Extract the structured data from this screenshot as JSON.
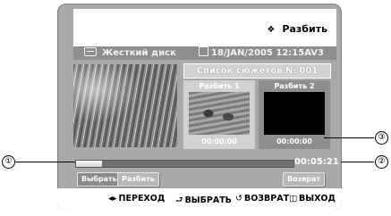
{
  "header": {
    "menu_title": "Разбить",
    "menu_icon": "diamond-icon"
  },
  "info": {
    "storage": "Жесткий диск",
    "datetime": "18/JAN/2005 12:15AV3"
  },
  "scene_list": {
    "title": "Список сюжетов № 001",
    "scenes": [
      {
        "label": "Разбить",
        "index": "1",
        "time": "00:00:00"
      },
      {
        "label": "Разбить",
        "index": "2",
        "time": "00:00:00"
      }
    ]
  },
  "playback": {
    "total_time": "00:05:21",
    "progress_fraction": 0.12
  },
  "buttons": {
    "select": "Выбрать",
    "split": "Разбить",
    "back": "Возврат"
  },
  "nav": {
    "move": "ПЕРЕХОД",
    "select": "ВЫБРАТЬ",
    "return": "ВОЗВРАТ",
    "exit": "ВЫХОД"
  },
  "callouts": {
    "one": "①",
    "two": "②",
    "three": "③"
  }
}
